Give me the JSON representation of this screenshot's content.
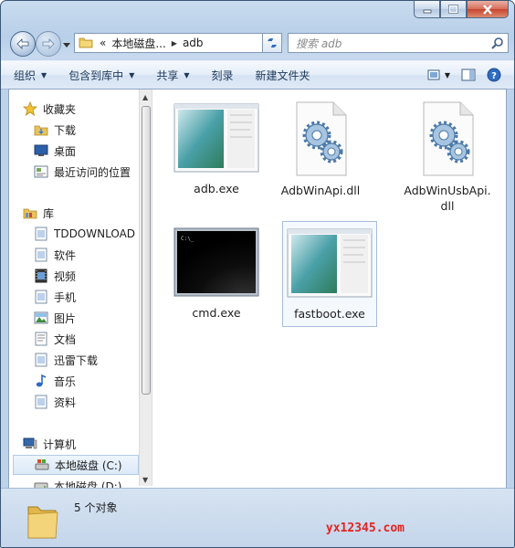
{
  "address": {
    "crumbs_prefix": "«",
    "crumb1": "本地磁盘...",
    "crumb2": "adb"
  },
  "search": {
    "placeholder": "搜索 adb"
  },
  "toolbar": {
    "organize": "组织",
    "include_library": "包含到库中",
    "share": "共享",
    "burn": "刻录",
    "new_folder": "新建文件夹"
  },
  "nav": {
    "favorites": "收藏夹",
    "downloads": "下载",
    "desktop": "桌面",
    "recent": "最近访问的位置",
    "libraries": "库",
    "tddownload": "TDDOWNLOAD",
    "software": "软件",
    "videos": "视频",
    "phone": "手机",
    "pictures": "图片",
    "documents": "文档",
    "xunlei": "迅雷下载",
    "music": "音乐",
    "materials": "资料",
    "computer": "计算机",
    "disk_c": "本地磁盘 (C:)",
    "disk_d": "本地磁盘 (D:)"
  },
  "files": [
    {
      "name": "adb.exe",
      "icon": "window-exe-icon"
    },
    {
      "name": "AdbWinApi.dll",
      "icon": "dll-gear-icon"
    },
    {
      "name": "AdbWinUsbApi.\ndll",
      "icon": "dll-gear-icon"
    },
    {
      "name": "cmd.exe",
      "icon": "console-exe-icon"
    },
    {
      "name": "fastboot.exe",
      "icon": "window-exe-icon"
    }
  ],
  "cmd_prompt": "C:\\_",
  "status": {
    "count": "5 个对象"
  },
  "watermark": "yx12345.com",
  "colors": {
    "accent": "#1e395b",
    "close": "#c6452c",
    "watermark": "#e3231f"
  }
}
